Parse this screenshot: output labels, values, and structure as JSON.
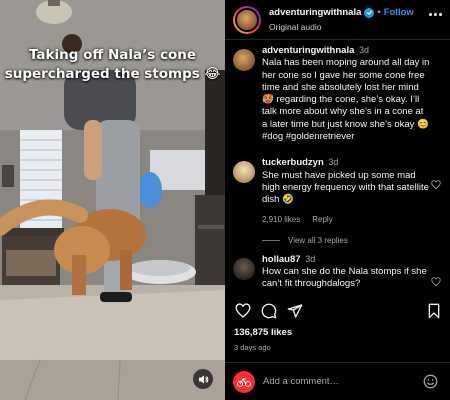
{
  "video": {
    "caption_line1": "Taking off Nala’s cone",
    "caption_line2": "supercharged the stomps 😂"
  },
  "header": {
    "username": "adventuringwithnala",
    "follow_label": "Follow",
    "audio_label": "Original audio"
  },
  "post_caption": {
    "username": "adventuringwithnala",
    "time": "3d",
    "text": "Nala has been moping around all day in her cone so I gave her some cone free time and she absolutely lost her mind 🥵 regarding the cone, she’s okay. I’ll talk more about why she’s in a cone at a later time but just know she’s okay 😊 #dog #goldenretriever"
  },
  "comments": [
    {
      "username": "tuckerbudzyn",
      "time": "3d",
      "text": "She must have picked up some mad high energy frequency with that satellite dish 🤣",
      "likes": "2,910 likes",
      "reply_label": "Reply",
      "view_replies": "View all 3 replies"
    },
    {
      "username": "hollau87",
      "time": "3d",
      "text": "How can she do the Nala stomps if she can’t fit throughdalogs?"
    }
  ],
  "footer": {
    "likes": "136,875 likes",
    "date": "3 days ago",
    "add_comment_placeholder": "Add a comment…"
  },
  "icons": {
    "heart": "heart-icon",
    "comment": "comment-icon",
    "share": "share-icon",
    "save": "bookmark-icon",
    "emoji": "emoji-icon",
    "mute": "speaker-icon"
  },
  "colors": {
    "accent": "#1d9bf0",
    "background": "#000000",
    "muted_text": "#a8a8a8"
  }
}
